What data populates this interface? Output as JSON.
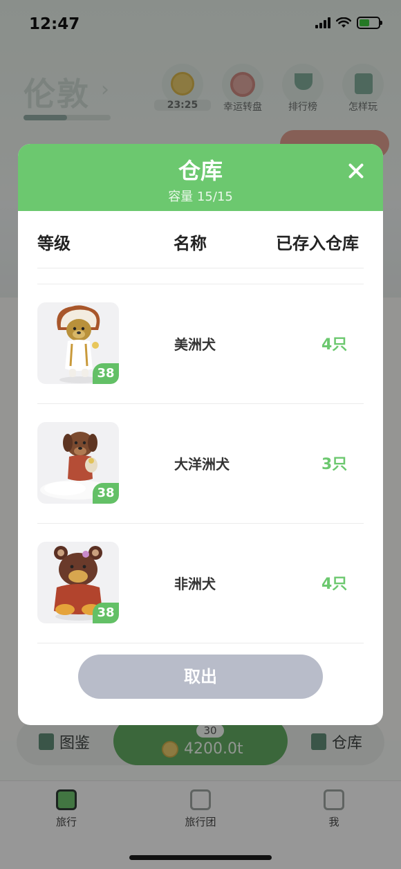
{
  "status_bar": {
    "time": "12:47"
  },
  "header": {
    "city": "伦敦",
    "city_progress": 0.5
  },
  "top_buttons": [
    {
      "label": "23:25",
      "icon": "coin-icon"
    },
    {
      "label": "幸运转盘",
      "icon": "wheel-icon"
    },
    {
      "label": "排行榜",
      "icon": "trophy-icon"
    },
    {
      "label": "怎样玩",
      "icon": "book-icon"
    }
  ],
  "bottom_bar": {
    "left_label": "图鉴",
    "right_label": "仓库",
    "badge": "30",
    "amount": "4200.0t"
  },
  "tabs": [
    {
      "label": "旅行",
      "active": true
    },
    {
      "label": "旅行团",
      "active": false
    },
    {
      "label": "我",
      "active": false
    }
  ],
  "modal": {
    "title": "仓库",
    "capacity": "容量 15/15",
    "columns": {
      "level": "等级",
      "name": "名称",
      "stored": "已存入仓库"
    },
    "items": [
      {
        "level": "38",
        "name": "美洲犬",
        "count": "4只",
        "icon": "headdress-dog-icon"
      },
      {
        "level": "38",
        "name": "大洋洲犬",
        "count": "3只",
        "icon": "cloud-dog-icon"
      },
      {
        "level": "38",
        "name": "非洲犬",
        "count": "4只",
        "icon": "bear-dog-icon"
      }
    ],
    "take_out_label": "取出"
  },
  "colors": {
    "accent": "#6cc86f",
    "disabled_button": "#b8bcc9",
    "overlay": "rgba(0,0,0,0.38)"
  }
}
